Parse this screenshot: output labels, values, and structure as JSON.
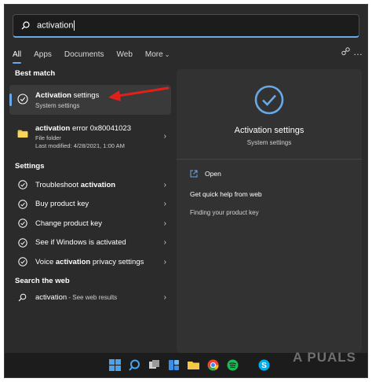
{
  "search": {
    "query": "activation"
  },
  "tabs": [
    {
      "label": "All"
    },
    {
      "label": "Apps"
    },
    {
      "label": "Documents"
    },
    {
      "label": "Web"
    },
    {
      "label": "More"
    }
  ],
  "best_match": {
    "section_title": "Best match",
    "title_bold": "Activation",
    "title_rest": " settings",
    "subtitle": "System settings"
  },
  "folder_result": {
    "title_bold": "activation",
    "title_rest": " error 0x80041023",
    "type": "File folder",
    "modified": "Last modified: 4/28/2021, 1:00 AM"
  },
  "settings": {
    "section_title": "Settings",
    "items": [
      {
        "pre": "Troubleshoot ",
        "bold": "activation",
        "post": ""
      },
      {
        "pre": "Buy product key",
        "bold": "",
        "post": ""
      },
      {
        "pre": "Change product key",
        "bold": "",
        "post": ""
      },
      {
        "pre": "See if Windows is activated",
        "bold": "",
        "post": ""
      },
      {
        "pre": "Voice ",
        "bold": "activation",
        "post": " privacy settings"
      }
    ]
  },
  "web": {
    "section_title": "Search the web",
    "query": "activation",
    "suffix": " - See web results"
  },
  "preview": {
    "title": "Activation settings",
    "subtitle": "System settings",
    "open_label": "Open",
    "help_label": "Get quick help from web",
    "link_label": "Finding your product key"
  },
  "watermark": "A  PUALS",
  "colors": {
    "accent": "#6aa9e8",
    "panel": "#2b2b2b",
    "annotation": "#e0201b"
  }
}
